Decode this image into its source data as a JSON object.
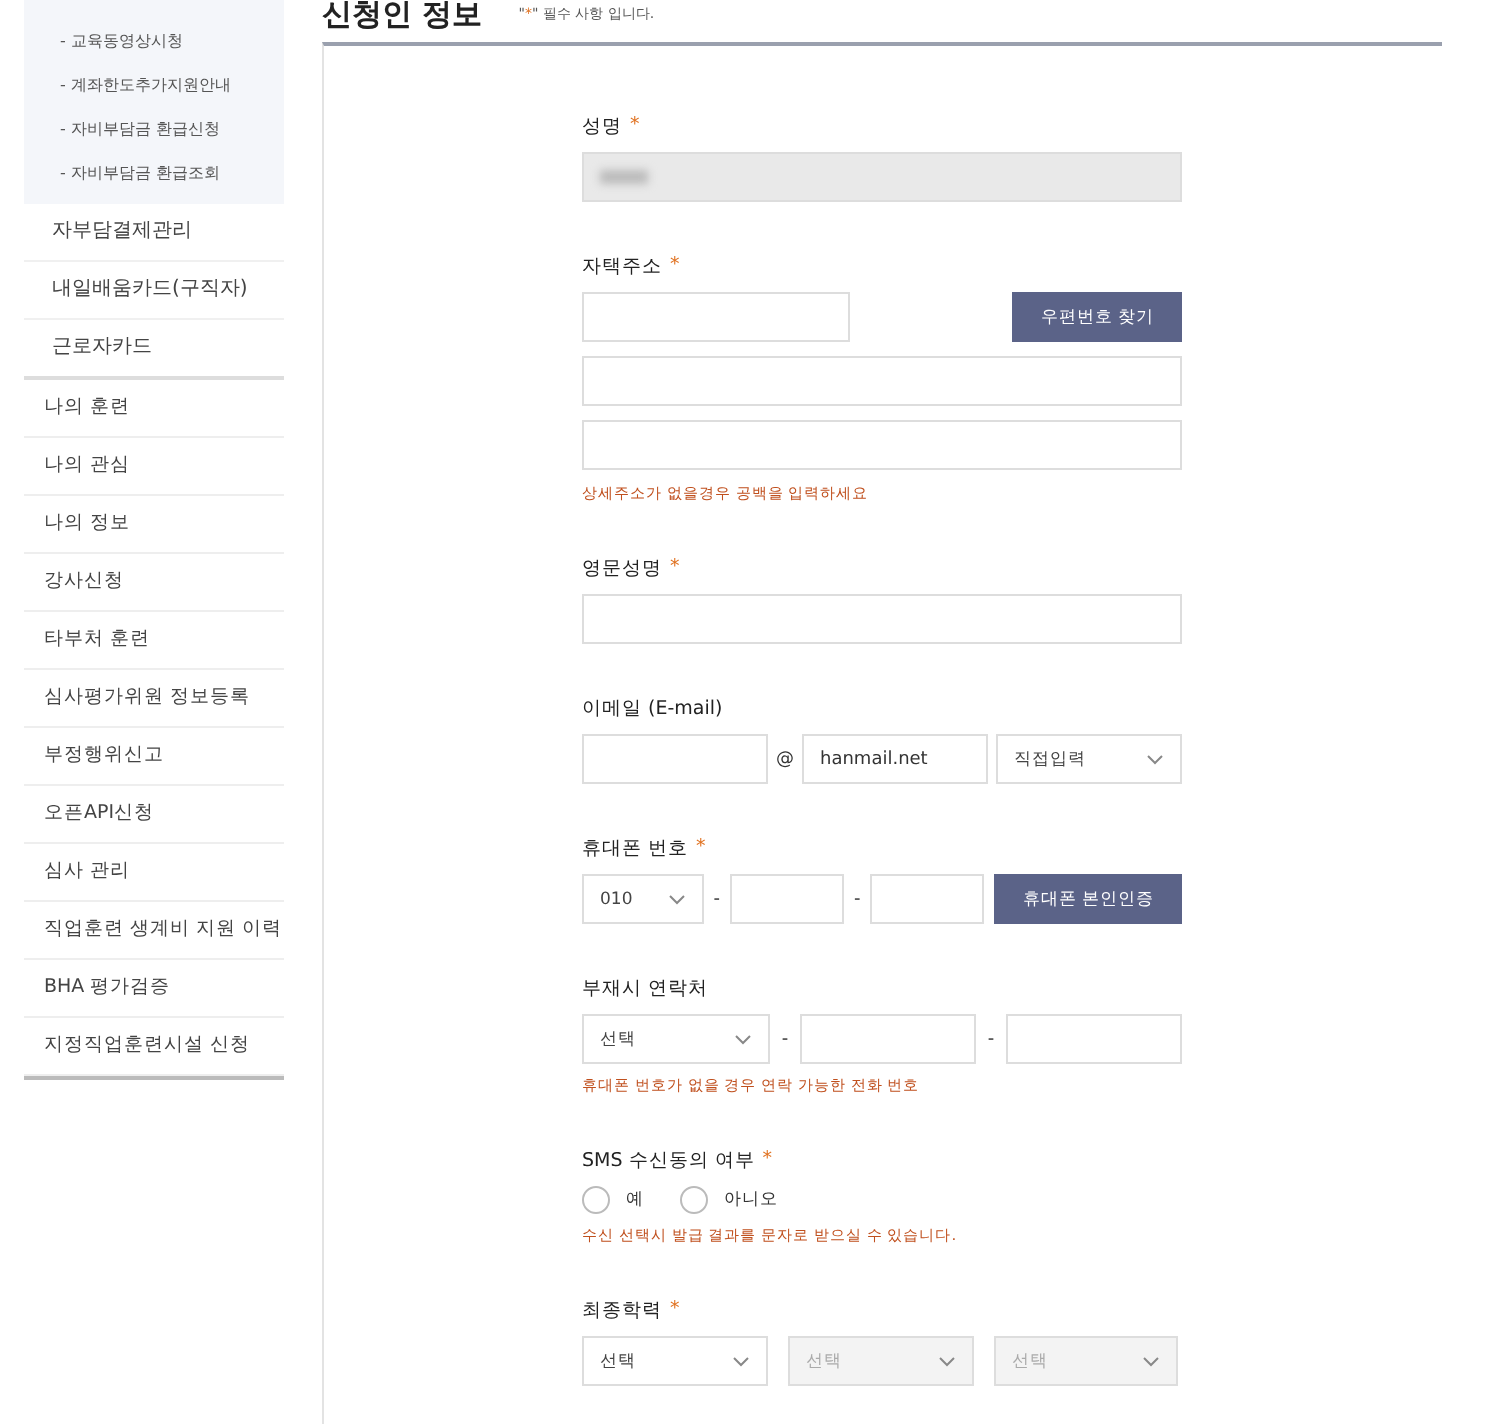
{
  "sidebar": {
    "sub_items": [
      "- 교육동영상시청",
      "- 계좌한도추가지원안내",
      "- 자비부담금 환급신청",
      "- 자비부담금 환급조회"
    ],
    "group_items": [
      "자부담결제관리",
      "내일배움카드(구직자)",
      "근로자카드"
    ],
    "items": [
      "나의 훈련",
      "나의 관심",
      "나의 정보",
      "강사신청",
      "타부처 훈련",
      "심사평가위원 정보등록",
      "부정행위신고",
      "오픈API신청",
      "심사 관리",
      "직업훈련 생계비 지원 이력",
      "BHA 평가검증",
      "지정직업훈련시설 신청"
    ]
  },
  "page": {
    "title": "신청인 정보",
    "required_note_prefix": "\"",
    "required_mark": "*",
    "required_note_suffix": "\" 필수 사항 입니다."
  },
  "form": [
    {
      "kind": "text",
      "label": "성명",
      "required": true,
      "blurred": true,
      "readonly": true
    },
    {
      "kind": "address",
      "label": "자택주소",
      "required": true,
      "button": "우편번호 찾기",
      "hint": "상세주소가 없을경우 공백을 입력하세요"
    },
    {
      "kind": "text",
      "label": "영문성명",
      "required": true,
      "blurred": false,
      "readonly": false
    },
    {
      "kind": "email",
      "label": "이메일 (E-mail)",
      "required": false,
      "at": "@",
      "domain": "hanmail.net",
      "select": "직접입력"
    },
    {
      "kind": "phone",
      "label": "휴대폰 번호",
      "required": true,
      "select": "010",
      "dash": "-",
      "button": "휴대폰 본인인증"
    },
    {
      "kind": "phone2",
      "label": "부재시 연락처",
      "required": false,
      "select": "선택",
      "dash": "-",
      "hint": "휴대폰 번호가 없을 경우 연락 가능한 전화 번호"
    },
    {
      "kind": "radio",
      "label": "SMS 수신동의 여부",
      "required": true,
      "options": [
        {
          "label": "예",
          "selected": false
        },
        {
          "label": "아니오",
          "selected": false
        }
      ],
      "hint": "수신 선택시 발급 결과를 문자로 받으실 수 있습니다."
    },
    {
      "kind": "selects",
      "label": "최종학력",
      "required": true,
      "selects": [
        {
          "text": "선택",
          "disabled": false
        },
        {
          "text": "선택",
          "disabled": true
        },
        {
          "text": "선택",
          "disabled": true
        }
      ]
    }
  ]
}
